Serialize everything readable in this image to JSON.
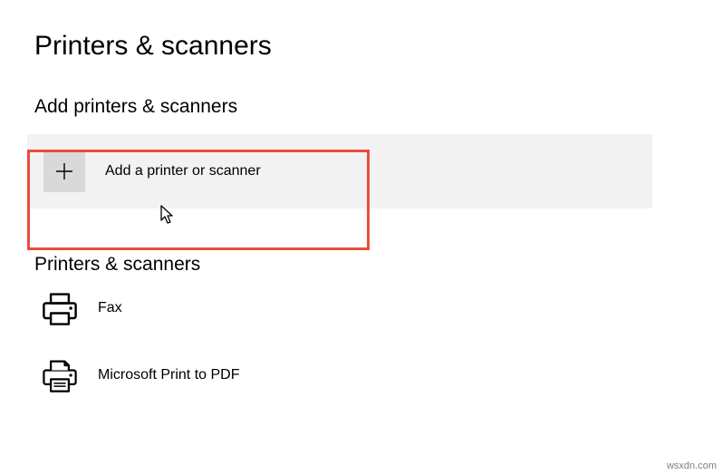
{
  "page": {
    "title": "Printers & scanners"
  },
  "add_section": {
    "title": "Add printers & scanners",
    "button_label": "Add a printer or scanner"
  },
  "printers_section": {
    "title": "Printers & scanners",
    "items": [
      {
        "label": "Fax"
      },
      {
        "label": "Microsoft Print to PDF"
      }
    ]
  },
  "watermark": "wsxdn.com"
}
